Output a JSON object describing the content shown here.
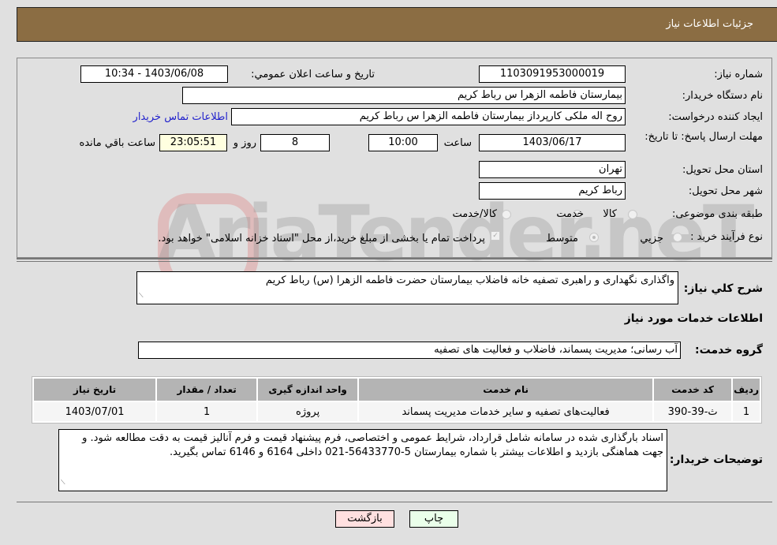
{
  "header": {
    "title": "جزئیات اطلاعات نیاز"
  },
  "form": {
    "need_number": {
      "label": "شماره نیاز:",
      "value": "1103091953000019"
    },
    "announce_datetime": {
      "label": "تاریخ و ساعت اعلان عمومي:",
      "value": "1403/06/08 - 10:34"
    },
    "buyer_org": {
      "label": "نام دستگاه خريدار:",
      "value": "بیمارستان فاطمه الزهرا س  رباط کریم"
    },
    "requester": {
      "label": "ایجاد کننده درخواست:",
      "value": "روح اله ملکی کارپرداز  بیمارستان فاطمه الزهرا س  رباط کریم"
    },
    "buyer_contact_link": "اطلاعات تماس خریدار",
    "deadline": {
      "label": "مهلت ارسال پاسخ: تا تاریخ:",
      "date": "1403/06/17",
      "time_label": "ساعت",
      "time": "10:00",
      "days": "8",
      "days_label": "روز و",
      "remaining": "23:05:51",
      "remaining_label": "ساعت باقي مانده"
    },
    "province": {
      "label": "استان محل تحویل:",
      "value": "تهران"
    },
    "city": {
      "label": "شهر محل تحویل:",
      "value": "رباط کریم"
    },
    "category": {
      "label": "طبقه بندی موضوعی:",
      "options": [
        "کالا",
        "خدمت",
        "کالا/خدمت"
      ],
      "selected": "خدمت"
    },
    "process_type": {
      "label": "نوع فرآیند خرید :",
      "options": [
        "جزيي",
        "متوسط"
      ],
      "selected": "متوسط",
      "treasury_checkbox_label": "پرداخت تمام یا بخشی از مبلغ خرید،از محل \"اسناد خزانه اسلامی\" خواهد بود.",
      "treasury_checked": true
    }
  },
  "description": {
    "label": "شرح کلي نياز:",
    "value": "واگذاری نگهداری و راهبری تصفیه خانه فاضلاب بیمارستان حضرت فاطمه الزهرا (س) رباط کریم"
  },
  "services_section_title": "اطلاعات خدمات مورد نياز",
  "service_group": {
    "label": "گروه خدمت:",
    "value": "آب رسانی؛ مدیریت پسماند، فاضلاب و فعالیت های تصفیه"
  },
  "table": {
    "headers": [
      "رديف",
      "کد خدمت",
      "نام خدمت",
      "واحد اندازه گیری",
      "تعداد / مقدار",
      "تاریخ نیاز"
    ],
    "rows": [
      [
        "1",
        "ث-39-390",
        "فعالیت‌های تصفیه و سایر خدمات مدیریت پسماند",
        "پروژه",
        "1",
        "1403/07/01"
      ]
    ]
  },
  "buyer_notes": {
    "label": "توضيحات خريدار:",
    "value": "اسناد بارگذاری شده در سامانه شامل قرارداد، شرایط عمومی و اختصاصی، فرم پیشنهاد قیمت و فرم آنالیز قیمت به دقت مطالعه شود. و جهت هماهنگی بازدید و اطلاعات بیشتر با شماره بیمارستان 5-56433770-021 داخلی 6164 و 6146 تماس بگیرید."
  },
  "buttons": {
    "print": "چاپ",
    "back": "بازگشت"
  },
  "watermark": "AriaTender.neT",
  "colors": {
    "header_bg": "#8b6d43",
    "print_bg": "#eaffea",
    "back_bg": "#ffe0e0",
    "link": "#2222cc"
  }
}
